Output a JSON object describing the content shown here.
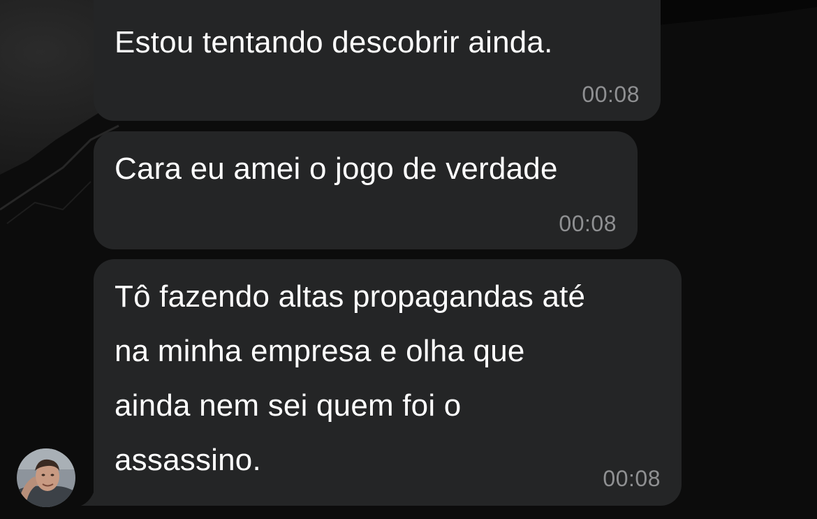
{
  "messages": [
    {
      "text": "Estou tentando descobrir ainda.",
      "time": "00:08"
    },
    {
      "text": "Cara eu amei o jogo de verdade",
      "time": "00:08"
    },
    {
      "text": "Tô fazendo altas propagandas até\nna minha empresa e olha que\nainda nem sei quem foi o\nassassino.",
      "time": "00:08"
    }
  ],
  "colors": {
    "background": "#060606",
    "bubble": "#242526",
    "text": "#ffffff",
    "timestamp": "#8f9092"
  },
  "icons": {
    "sender_avatar": "avatar"
  }
}
